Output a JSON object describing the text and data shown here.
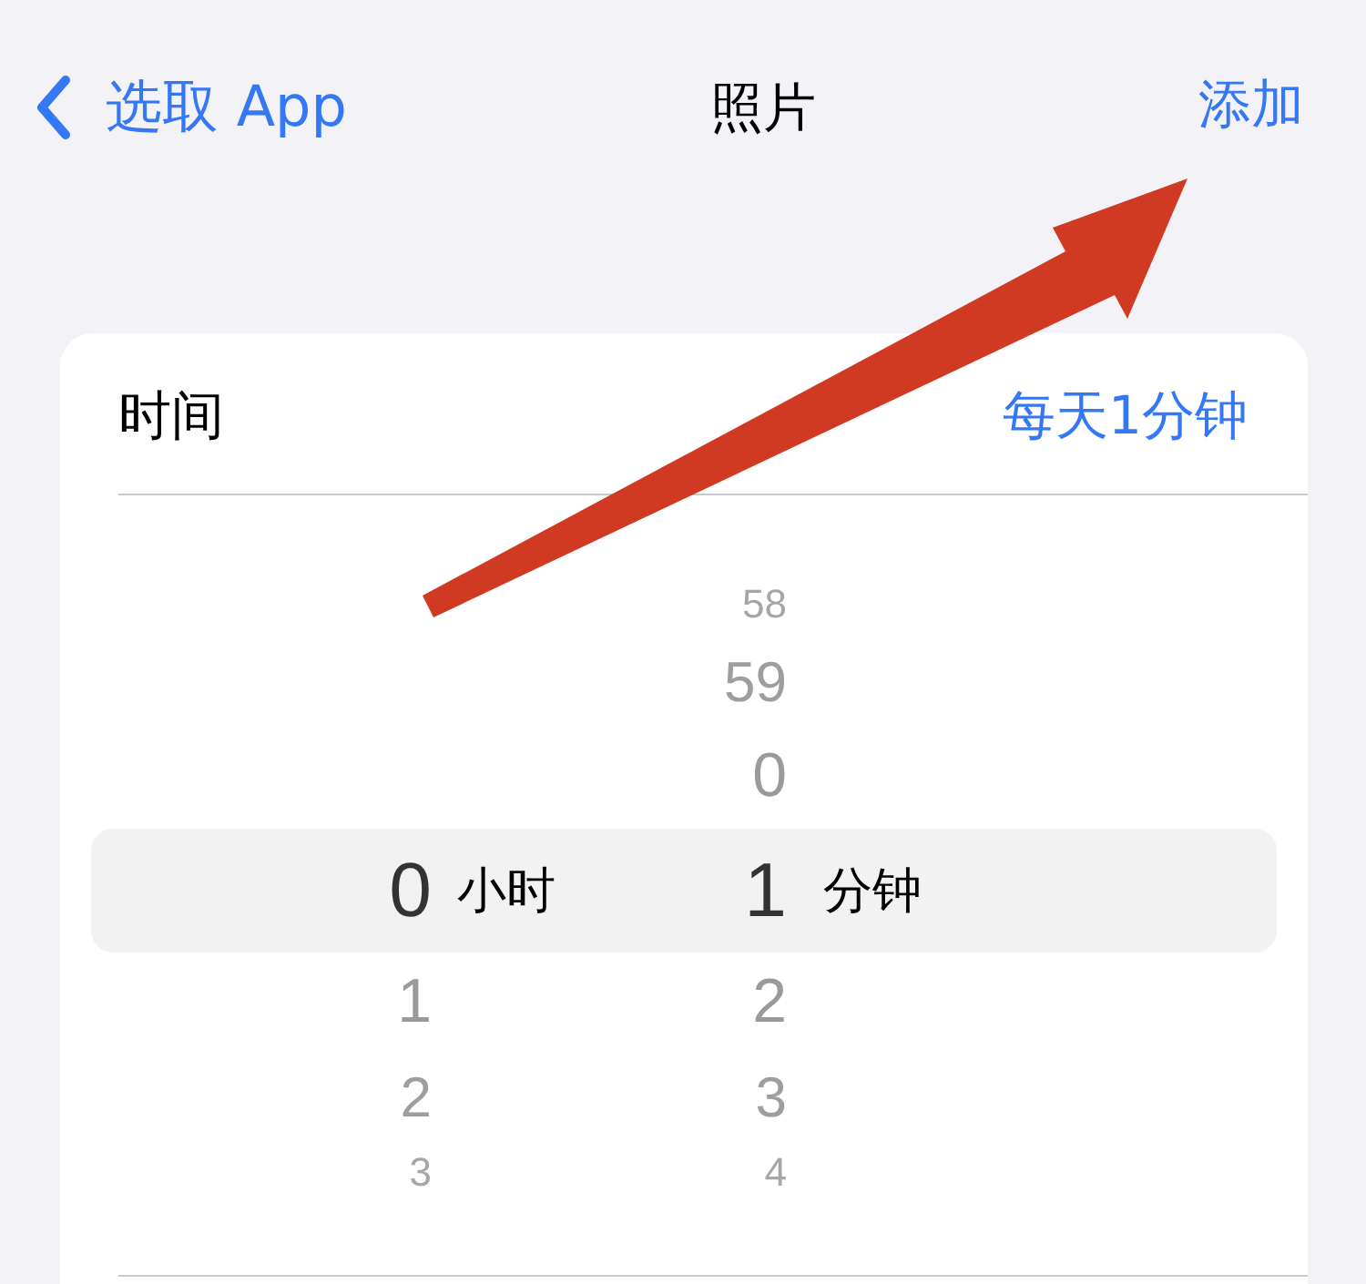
{
  "nav": {
    "back": "选取 App",
    "title": "照片",
    "action": "添加"
  },
  "setting": {
    "label": "时间",
    "value": "每天1分钟"
  },
  "picker": {
    "columns": [
      {
        "unit": "小时",
        "items": [
          {
            "value": "0",
            "selected": true
          },
          {
            "value": "1",
            "selected": false
          },
          {
            "value": "2",
            "selected": false
          },
          {
            "value": "3",
            "selected": false
          }
        ]
      },
      {
        "unit": "分钟",
        "items": [
          {
            "value": "58",
            "selected": false
          },
          {
            "value": "59",
            "selected": false
          },
          {
            "value": "0",
            "selected": false
          },
          {
            "value": "1",
            "selected": true
          },
          {
            "value": "2",
            "selected": false
          },
          {
            "value": "3",
            "selected": false
          },
          {
            "value": "4",
            "selected": false
          }
        ]
      }
    ]
  },
  "annotation": {
    "kind": "arrow"
  }
}
